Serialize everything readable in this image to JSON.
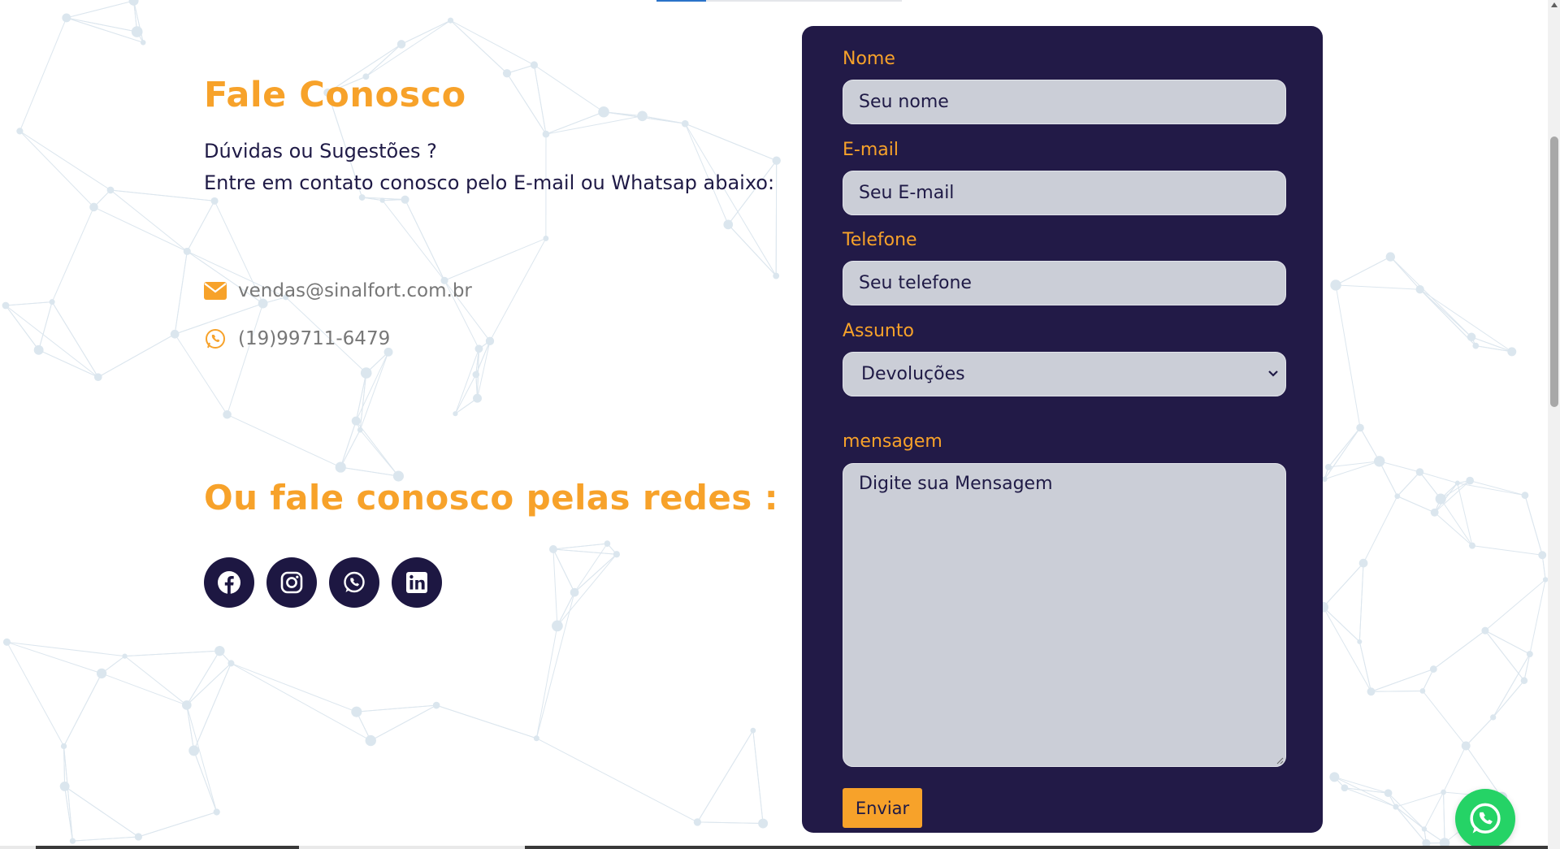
{
  "contact": {
    "title": "Fale Conosco",
    "intro_line1": "Dúvidas  ou  Sugestões ?",
    "intro_line2": "Entre em contato conosco pelo E-mail ou Whatsap abaixo:",
    "email": "vendas@sinalfort.com.br",
    "phone": "(19)99711-6479",
    "social_title": "Ou fale conosco pelas redes :",
    "socials": [
      "facebook-icon",
      "instagram-icon",
      "whatsapp-icon",
      "linkedin-icon"
    ]
  },
  "form": {
    "name_label": "Nome",
    "name_placeholder": "Seu nome",
    "email_label": "E-mail",
    "email_placeholder": "Seu E-mail",
    "phone_label": "Telefone",
    "phone_placeholder": "Seu telefone",
    "subject_label": "Assunto",
    "subject_selected": "Devoluções",
    "message_label": "mensagem",
    "message_placeholder": "Digite sua Mensagem",
    "submit_label": "Enviar"
  },
  "colors": {
    "accent": "#f7a22a",
    "navy": "#1f1a46",
    "panel": "#221a47",
    "field": "#cbced7",
    "whatsapp": "#25d366"
  }
}
